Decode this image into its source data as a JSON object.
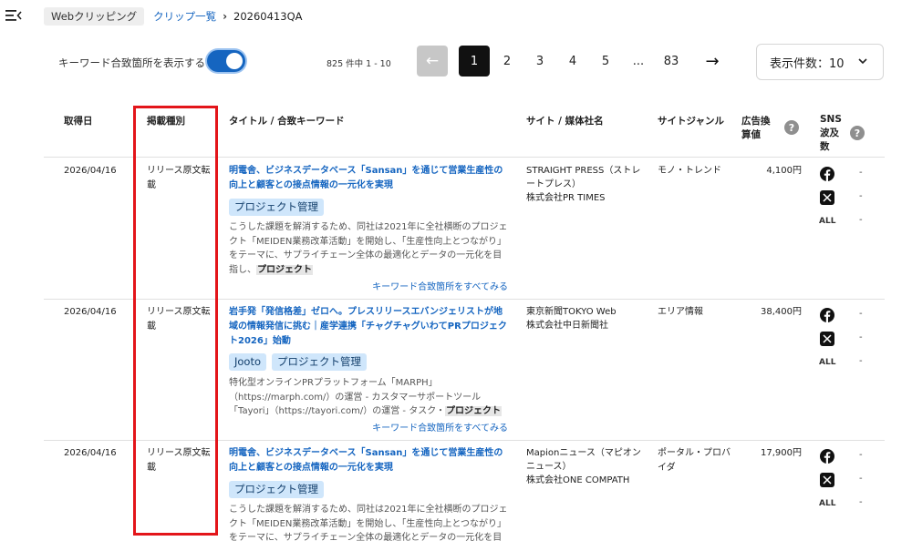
{
  "breadcrumb": {
    "root": "Webクリッピング",
    "parent": "クリップ一覧",
    "current": "20260413QA"
  },
  "toolbar": {
    "keyword_toggle_label": "キーワード合致箇所を表示する",
    "keyword_toggle_on": true,
    "result_count": "825 件中 1 - 10",
    "pages": [
      "1",
      "2",
      "3",
      "4",
      "5",
      "...",
      "83"
    ],
    "active_page": "1",
    "per_page_label": "表示件数：10"
  },
  "columns": {
    "date": "取得日",
    "type": "掲載種別",
    "title": "タイトル / 合致キーワード",
    "site": "サイト / 媒体社名",
    "genre": "サイトジャンル",
    "ad_value": "広告換算値",
    "sns": "SNS波及数"
  },
  "rows": [
    {
      "date": "2026/04/16",
      "type": "リリース原文転載",
      "title": "明電舎、ビジネスデータベース「Sansan」を通じて営業生産性の向上と顧客との接点情報の一元化を実現",
      "tags": [
        "プロジェクト管理"
      ],
      "snippet": "こうした課題を解消するため、同社は2021年に全社横断のプロジェクト「MEIDEN業務改革活動」を開始し、「生産性向上とつながり」をテーマに、サプライチェーン全体の最適化とデータの一元化を目指し、",
      "snippet_hl": "プロジェクト",
      "see_all": "キーワード合致箇所をすべてみる",
      "site": "STRAIGHT PRESS（ストレートプレス）",
      "publisher": "株式会社PR TIMES",
      "genre": "モノ・トレンド",
      "ad_value": "4,100円",
      "sns": {
        "facebook": "-",
        "x": "-",
        "all": "-",
        "all_label": "ALL"
      }
    },
    {
      "date": "2026/04/16",
      "type": "リリース原文転載",
      "title": "岩手発「発信格差」ゼロへ。プレスリリースエバンジェリストが地域の情報発信に挑む｜産学連携「チャグチャグいわてPRプロジェクト2026」始動",
      "tags": [
        "Jooto",
        "プロジェクト管理"
      ],
      "snippet": "特化型オンラインPRプラットフォーム「MARPH」（https://marph.com/）の運営 - カスタマーサポートツール「Tayori」（https://tayori.com/）の運営 - タスク・",
      "snippet_hl": "プロジェクト",
      "see_all": "キーワード合致箇所をすべてみる",
      "site": "東京新聞TOKYO Web",
      "publisher": "株式会社中日新聞社",
      "genre": "エリア情報",
      "ad_value": "38,400円",
      "sns": {
        "facebook": "-",
        "x": "-",
        "all": "-",
        "all_label": "ALL"
      }
    },
    {
      "date": "2026/04/16",
      "type": "リリース原文転載",
      "title": "明電舎、ビジネスデータベース「Sansan」を通じて営業生産性の向上と顧客との接点情報の一元化を実現",
      "tags": [
        "プロジェクト管理"
      ],
      "snippet": "こうした課題を解消するため、同社は2021年に全社横断のプロジェクト「MEIDEN業務改革活動」を開始し、「生産性向上とつながり」をテーマに、サプライチェーン全体の最適化とデータの一元化を目",
      "snippet_hl": "",
      "see_all": "",
      "site": "Mapionニュース（マピオンニュース）",
      "publisher": "株式会社ONE COMPATH",
      "genre": "ポータル・プロバイダ",
      "ad_value": "17,900円",
      "sns": {
        "facebook": "-",
        "x": "-",
        "all": "-",
        "all_label": "ALL"
      }
    }
  ],
  "colors": {
    "accent": "#1565c0",
    "tag_bg": "#cfe6fb",
    "highlight_box": "#e3151a"
  }
}
